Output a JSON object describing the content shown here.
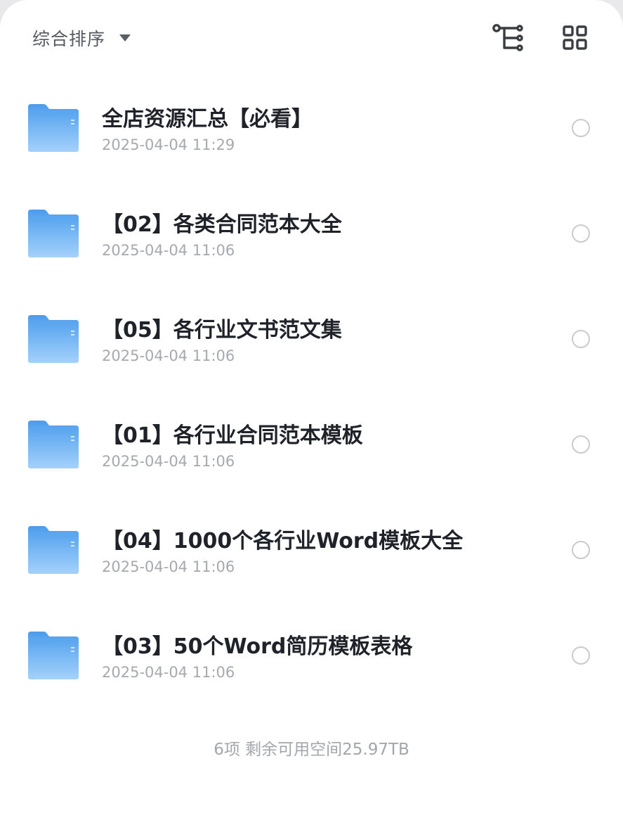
{
  "toolbar": {
    "sort_label": "综合排序",
    "sort_icon": "caret-down-icon",
    "tree_icon": "folder-tree-icon",
    "grid_icon": "grid-view-icon"
  },
  "colors": {
    "folder_top": "#5aa6ef",
    "folder_bottom": "#a4d1fb",
    "title_text": "#1f2329",
    "secondary_text": "#a6a9ae"
  },
  "files": [
    {
      "name": "全店资源汇总【必看】",
      "date": "2025-04-04 11:29",
      "icon": "folder-icon"
    },
    {
      "name": "【02】各类合同范本大全",
      "date": "2025-04-04 11:06",
      "icon": "folder-icon"
    },
    {
      "name": "【05】各行业文书范文集",
      "date": "2025-04-04 11:06",
      "icon": "folder-icon"
    },
    {
      "name": "【01】各行业合同范本模板",
      "date": "2025-04-04 11:06",
      "icon": "folder-icon"
    },
    {
      "name": "【04】1000个各行业Word模板大全",
      "date": "2025-04-04 11:06",
      "icon": "folder-icon"
    },
    {
      "name": "【03】50个Word简历模板表格",
      "date": "2025-04-04 11:06",
      "icon": "folder-icon"
    }
  ],
  "footer": {
    "summary": "6项 剩余可用空间25.97TB"
  }
}
